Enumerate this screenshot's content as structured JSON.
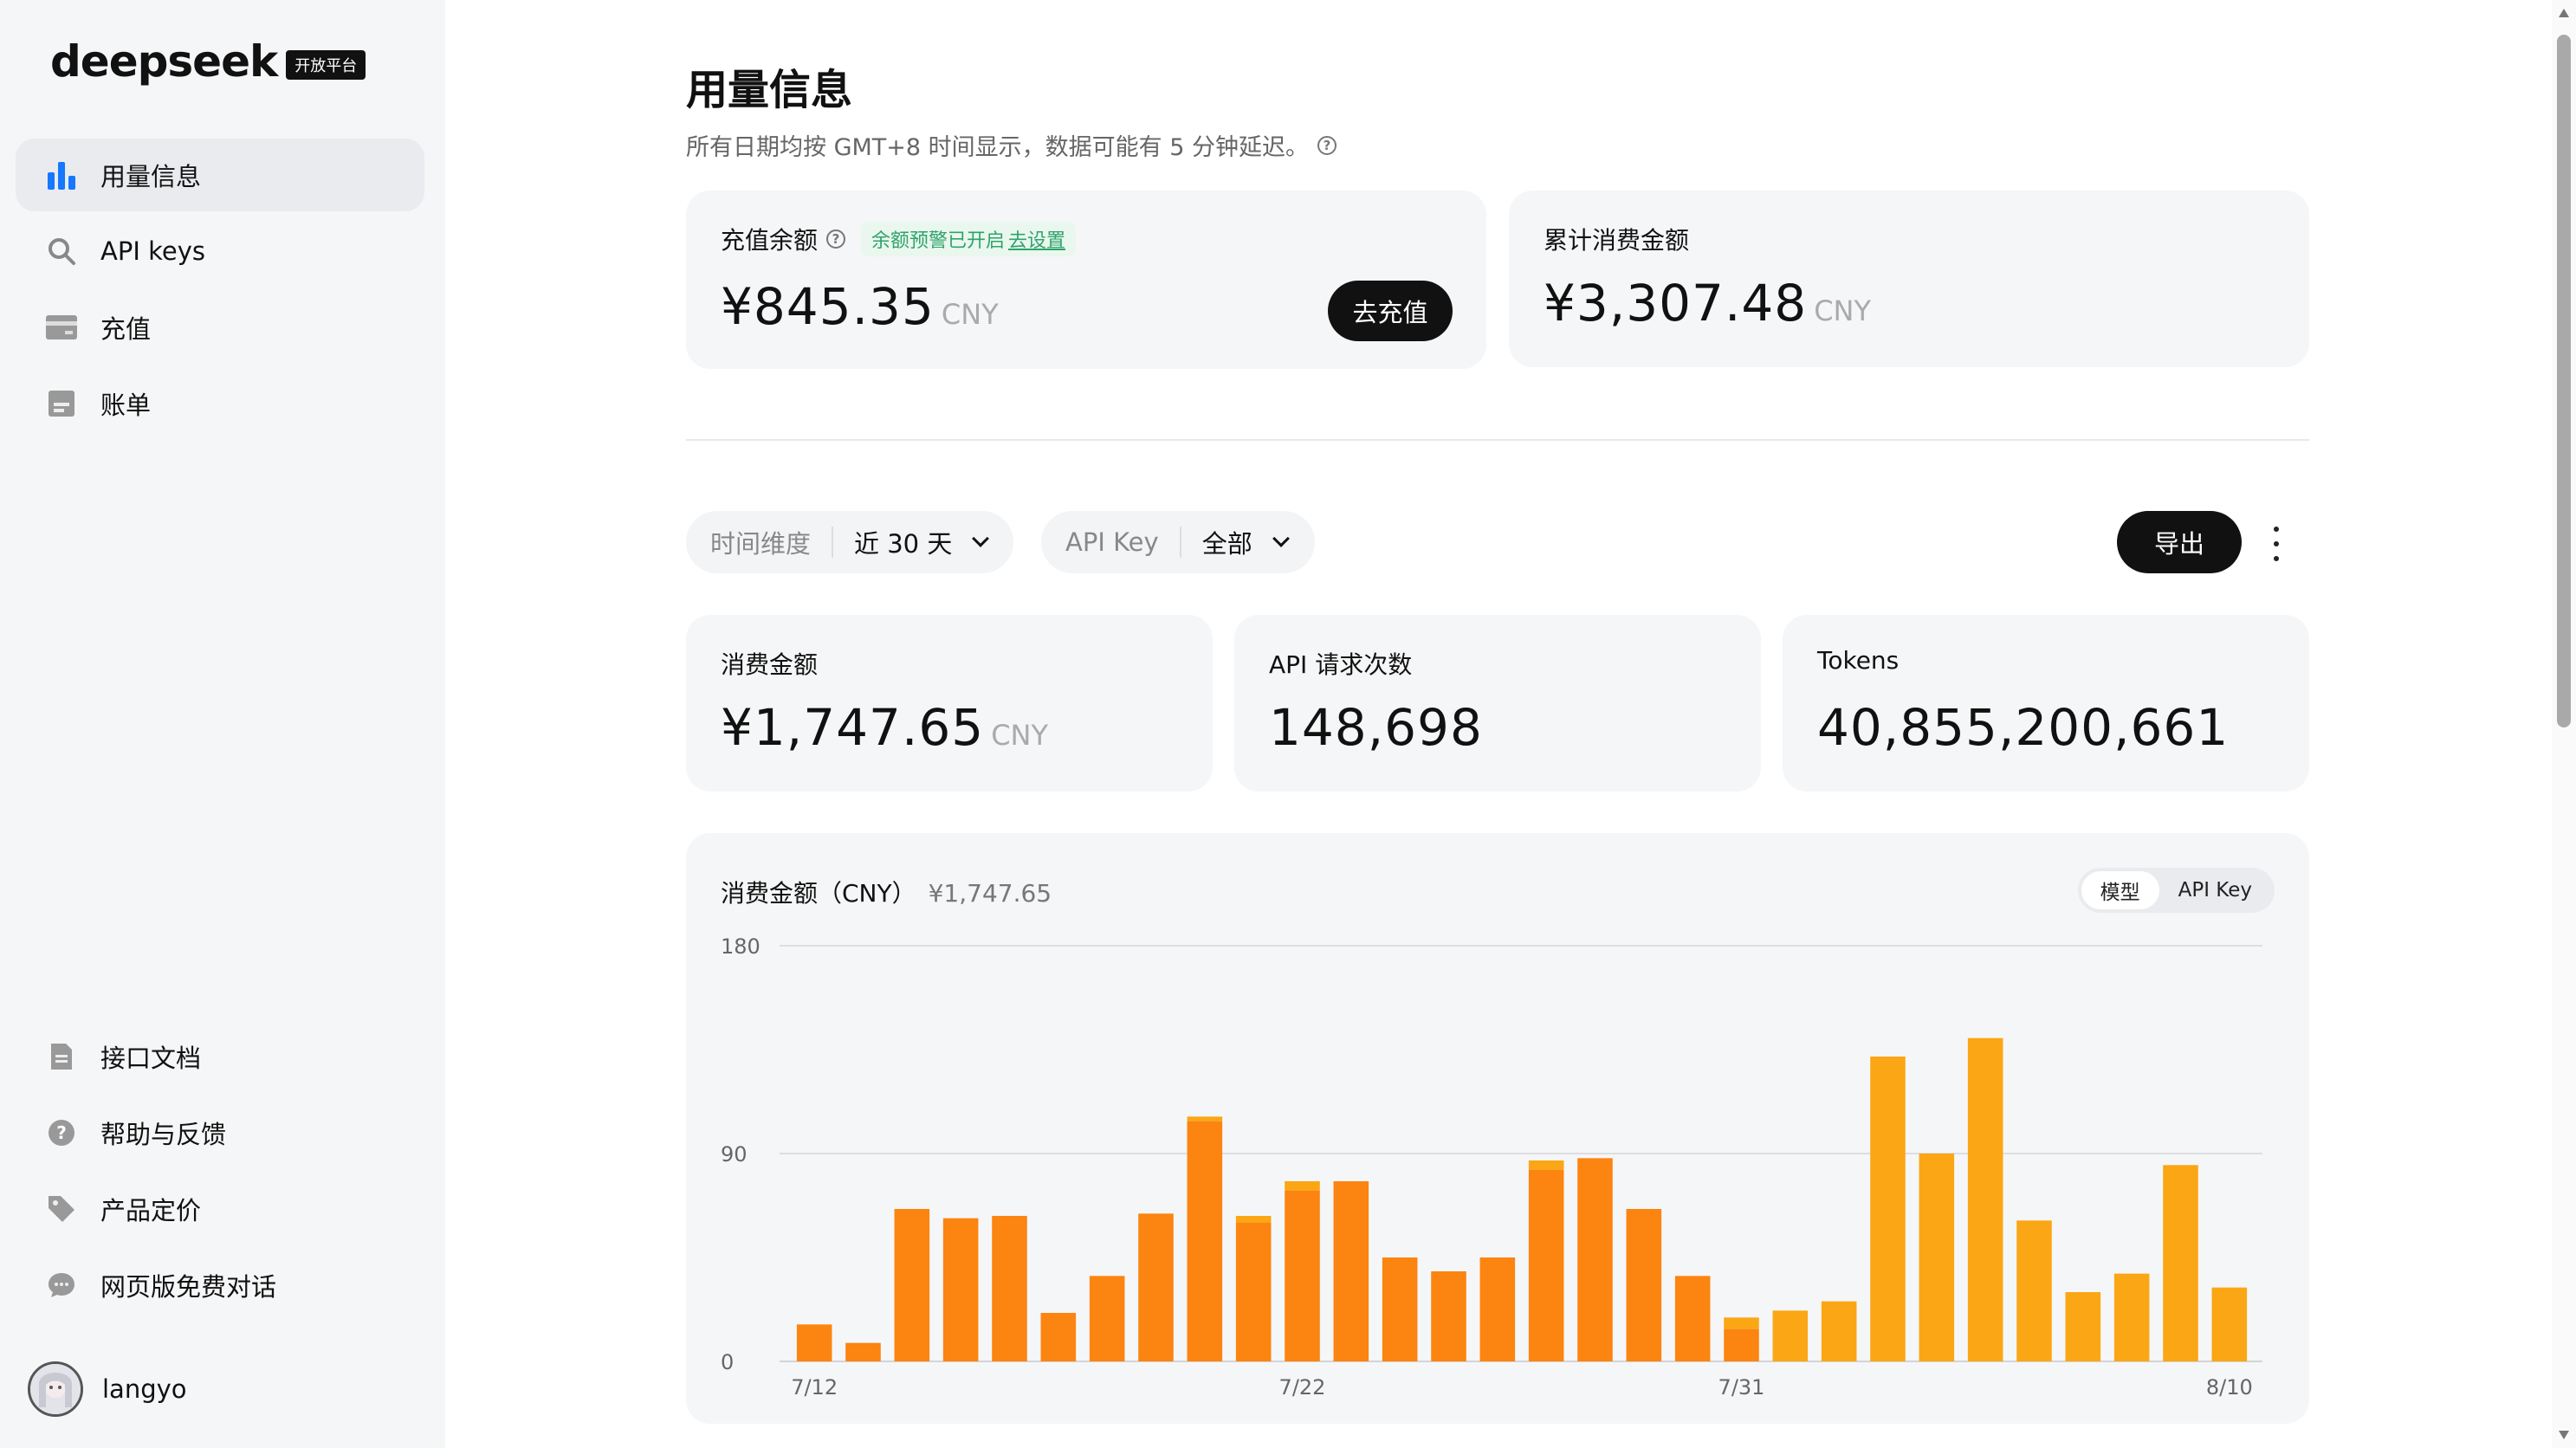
{
  "brand": {
    "name": "deepseek",
    "badge": "开放平台"
  },
  "sidebar": {
    "top_items": [
      {
        "label": "用量信息",
        "icon": "bar-chart-icon",
        "active": true
      },
      {
        "label": "API keys",
        "icon": "search-key-icon",
        "active": false
      },
      {
        "label": "充值",
        "icon": "card-icon",
        "active": false
      },
      {
        "label": "账单",
        "icon": "bill-icon",
        "active": false
      }
    ],
    "bottom_items": [
      {
        "label": "接口文档",
        "icon": "document-icon"
      },
      {
        "label": "帮助与反馈",
        "icon": "help-icon"
      },
      {
        "label": "产品定价",
        "icon": "tag-icon"
      },
      {
        "label": "网页版免费对话",
        "icon": "chat-icon"
      }
    ],
    "user": {
      "name": "langyo"
    }
  },
  "header": {
    "title": "用量信息",
    "subtitle": "所有日期均按 GMT+8 时间显示，数据可能有 5 分钟延迟。"
  },
  "balance": {
    "label": "充值余额",
    "alert_text": "余额预警已开启",
    "alert_link": "去设置",
    "value": "¥845.35",
    "unit": "CNY",
    "button": "去充值"
  },
  "total_spent": {
    "label": "累计消费金额",
    "value": "¥3,307.48",
    "unit": "CNY"
  },
  "filters": {
    "time": {
      "label": "时间维度",
      "value": "近 30 天"
    },
    "apikey": {
      "label": "API Key",
      "value": "全部"
    },
    "export": "导出"
  },
  "stats": {
    "cost": {
      "label": "消费金额",
      "value": "¥1,747.65",
      "unit": "CNY"
    },
    "requests": {
      "label": "API 请求次数",
      "value": "148,698"
    },
    "tokens": {
      "label": "Tokens",
      "value": "40,855,200,661"
    }
  },
  "chart": {
    "title": "消费金额（CNY）",
    "total": "¥1,747.65",
    "toggle": [
      "模型",
      "API Key"
    ]
  },
  "colors": {
    "series_a": "#fc8410",
    "series_b": "#fba614",
    "accent_blue": "#1677ff",
    "alert_green": "#2fa36b"
  },
  "chart_data": {
    "type": "bar",
    "stacked": true,
    "x": [
      "7/12",
      "7/13",
      "7/14",
      "7/15",
      "7/16",
      "7/17",
      "7/18",
      "7/19",
      "7/20",
      "7/21",
      "7/22",
      "7/23",
      "7/24",
      "7/25",
      "7/26",
      "7/27",
      "7/28",
      "7/29",
      "7/30",
      "7/31",
      "8/1",
      "8/2",
      "8/3",
      "8/4",
      "8/5",
      "8/6",
      "8/7",
      "8/8",
      "8/9",
      "8/10"
    ],
    "x_tick_labels": [
      "7/12",
      "7/22",
      "7/31",
      "8/10"
    ],
    "ylim": [
      0,
      180
    ],
    "yticks": [
      0,
      90,
      180
    ],
    "series": [
      {
        "values": [
          16,
          8,
          66,
          62,
          63,
          21,
          37,
          64,
          104,
          60,
          74,
          78,
          45,
          39,
          45,
          83,
          88,
          66,
          37,
          14,
          0,
          0,
          0,
          0,
          0,
          0,
          0,
          0,
          0,
          0
        ]
      },
      {
        "values": [
          0,
          0,
          0,
          0,
          0,
          0,
          0,
          0,
          2,
          3,
          4,
          0,
          0,
          0,
          0,
          4,
          0,
          0,
          0,
          5,
          22,
          26,
          132,
          90,
          140,
          61,
          30,
          38,
          85,
          32
        ]
      }
    ],
    "legend": "none",
    "grid": true
  }
}
